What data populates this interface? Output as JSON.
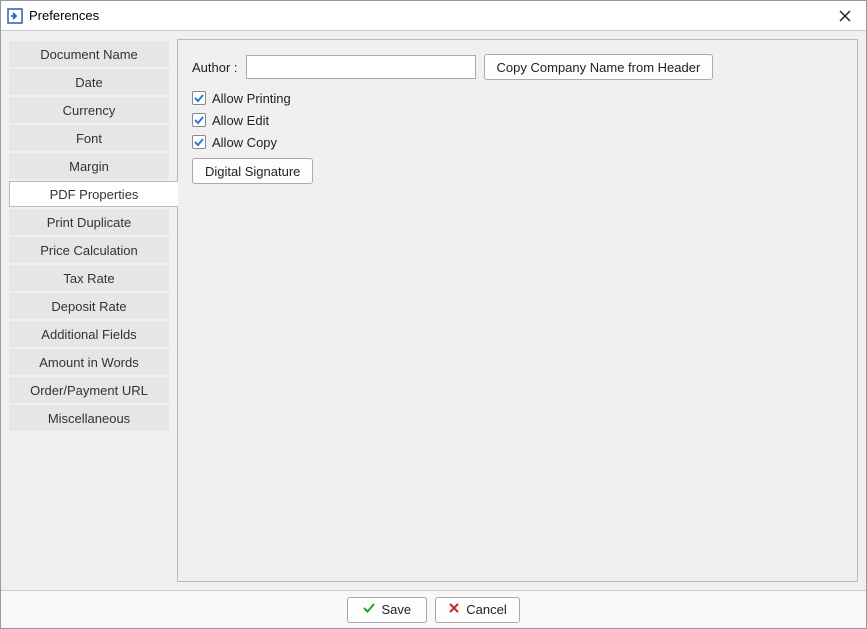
{
  "window": {
    "title": "Preferences"
  },
  "sidebar": {
    "items": [
      {
        "label": "Document Name",
        "selected": false
      },
      {
        "label": "Date",
        "selected": false
      },
      {
        "label": "Currency",
        "selected": false
      },
      {
        "label": "Font",
        "selected": false
      },
      {
        "label": "Margin",
        "selected": false
      },
      {
        "label": "PDF Properties",
        "selected": true
      },
      {
        "label": "Print Duplicate",
        "selected": false
      },
      {
        "label": "Price Calculation",
        "selected": false
      },
      {
        "label": "Tax Rate",
        "selected": false
      },
      {
        "label": "Deposit Rate",
        "selected": false
      },
      {
        "label": "Additional Fields",
        "selected": false
      },
      {
        "label": "Amount in Words",
        "selected": false
      },
      {
        "label": "Order/Payment URL",
        "selected": false
      },
      {
        "label": "Miscellaneous",
        "selected": false
      }
    ]
  },
  "content": {
    "author_label": "Author :",
    "author_value": "",
    "copy_company_button": "Copy Company Name from Header",
    "allow_printing": {
      "label": "Allow Printing",
      "checked": true
    },
    "allow_edit": {
      "label": "Allow Edit",
      "checked": true
    },
    "allow_copy": {
      "label": "Allow Copy",
      "checked": true
    },
    "digital_signature_button": "Digital Signature"
  },
  "footer": {
    "save_label": "Save",
    "cancel_label": "Cancel"
  }
}
